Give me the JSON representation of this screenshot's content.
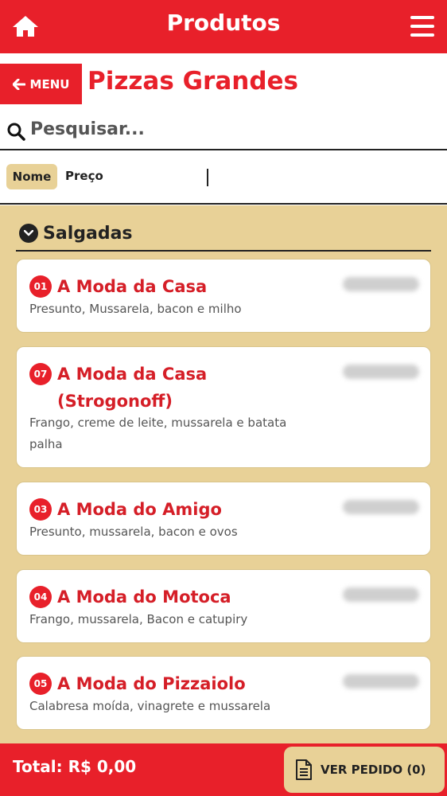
{
  "header": {
    "title": "Produtos",
    "home_icon": "home-icon",
    "menu_icon": "hamburger-icon"
  },
  "nav": {
    "back_label": "MENU",
    "back_icon": "arrow-left-icon",
    "category_title": "Pizzas Grandes"
  },
  "search": {
    "placeholder": "Pesquisar...",
    "icon": "search-icon"
  },
  "sort": {
    "options": [
      "Nome",
      "Preço"
    ],
    "selected": "Nome"
  },
  "section": {
    "label": "Salgadas",
    "icon": "chevron-down-circle-icon"
  },
  "products": [
    {
      "number": "01",
      "name": "A Moda da Casa",
      "description": "Presunto, Mussarela, bacon e milho"
    },
    {
      "number": "07",
      "name": "A Moda da Casa (Strogonoff)",
      "description": "Frango, creme de leite, mussarela e batata palha"
    },
    {
      "number": "03",
      "name": "A Moda do Amigo",
      "description": "Presunto, mussarela, bacon e ovos"
    },
    {
      "number": "04",
      "name": "A Moda do Motoca",
      "description": "Frango, mussarela, Bacon e catupiry"
    },
    {
      "number": "05",
      "name": "A Moda do Pizzaiolo",
      "description": "Calabresa moída, vinagrete e mussarela"
    }
  ],
  "footer": {
    "total": "Total: R$ 0,00",
    "order_label": "VER PEDIDO (0)",
    "order_icon": "document-icon"
  },
  "colors": {
    "primary": "#e8202a",
    "accent_bg": "#e8d197",
    "card_bg": "#ffffff"
  }
}
